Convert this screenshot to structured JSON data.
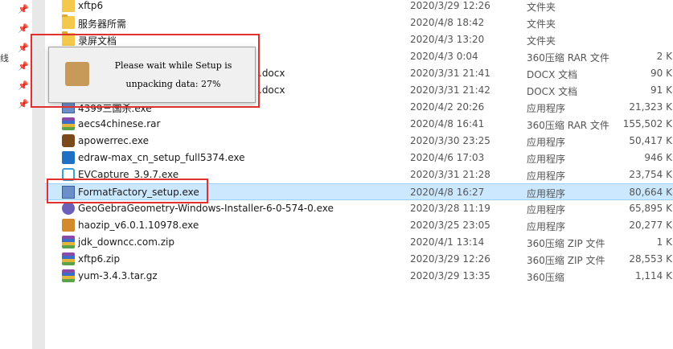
{
  "nav": {
    "edge_char": "线"
  },
  "files": [
    {
      "name": "xftp6",
      "date": "2020/3/29 12:26",
      "type": "文件夹",
      "size": "",
      "icon": "folder-icon",
      "cls": "folder-ico"
    },
    {
      "name": "服务器所需",
      "date": "2020/4/8 18:42",
      "type": "文件夹",
      "size": "",
      "icon": "folder-icon",
      "cls": "folder-ico"
    },
    {
      "name": "录屏文档",
      "date": "2020/4/3 13:20",
      "type": "文件夹",
      "size": "",
      "icon": "folder-icon",
      "cls": "folder-ico"
    },
    {
      "name": "",
      "date": "2020/4/3 0:04",
      "type": "360压缩 RAR 文件",
      "size": "2 K",
      "icon": "archive-icon",
      "cls": "rar-ico"
    },
    {
      "name": ".docx",
      "date": "2020/3/31 21:41",
      "type": "DOCX 文档",
      "size": "90 K",
      "icon": "document-icon",
      "cls": ""
    },
    {
      "name": ".docx",
      "date": "2020/3/31 21:42",
      "type": "DOCX 文档",
      "size": "91 K",
      "icon": "document-icon",
      "cls": ""
    },
    {
      "name": "4399三国杀.exe",
      "date": "2020/4/2 20:26",
      "type": "应用程序",
      "size": "21,323 K",
      "icon": "exe-icon",
      "cls": "exe-ico"
    },
    {
      "name": "aecs4chinese.rar",
      "date": "2020/4/8 16:41",
      "type": "360压缩 RAR 文件",
      "size": "155,502 K",
      "icon": "archive-icon",
      "cls": "rar-ico"
    },
    {
      "name": "apowerrec.exe",
      "date": "2020/3/30 23:25",
      "type": "应用程序",
      "size": "50,417 K",
      "icon": "recorder-icon",
      "cls": "rec-ico"
    },
    {
      "name": "edraw-max_cn_setup_full5374.exe",
      "date": "2020/4/6 17:03",
      "type": "应用程序",
      "size": "946 K",
      "icon": "edraw-icon",
      "cls": "edraw-ico"
    },
    {
      "name": "EVCapture_3.9.7.exe",
      "date": "2020/3/31 21:28",
      "type": "应用程序",
      "size": "23,754 K",
      "icon": "capture-icon",
      "cls": "evc-ico"
    },
    {
      "name": "FormatFactory_setup.exe",
      "date": "2020/4/8 16:27",
      "type": "应用程序",
      "size": "80,664 K",
      "icon": "installer-icon",
      "cls": "exe-ico",
      "selected": true
    },
    {
      "name": "GeoGebraGeometry-Windows-Installer-6-0-574-0.exe",
      "date": "2020/3/28 11:19",
      "type": "应用程序",
      "size": "65,895 K",
      "icon": "geogebra-icon",
      "cls": "geo-ico"
    },
    {
      "name": "haozip_v6.0.1.10978.exe",
      "date": "2020/3/25 23:05",
      "type": "应用程序",
      "size": "20,277 K",
      "icon": "haozip-icon",
      "cls": "hz-ico"
    },
    {
      "name": "jdk_downcc.com.zip",
      "date": "2020/4/1 13:14",
      "type": "360压缩 ZIP 文件",
      "size": "1 K",
      "icon": "archive-icon",
      "cls": "rar-ico"
    },
    {
      "name": "xftp6.zip",
      "date": "2020/3/29 12:26",
      "type": "360压缩 ZIP 文件",
      "size": "28,553 K",
      "icon": "archive-icon",
      "cls": "rar-ico"
    },
    {
      "name": "yum-3.4.3.tar.gz",
      "date": "2020/3/29 13:35",
      "type": "360压缩",
      "size": "1,114 K",
      "icon": "archive-icon",
      "cls": "rar-ico"
    }
  ],
  "dialog": {
    "line1": "Please wait while Setup is",
    "line2": "unpacking data: 27%",
    "progress_percent": 27
  },
  "colors": {
    "selection_bg": "#cce8ff",
    "highlight_border": "#e03030"
  }
}
